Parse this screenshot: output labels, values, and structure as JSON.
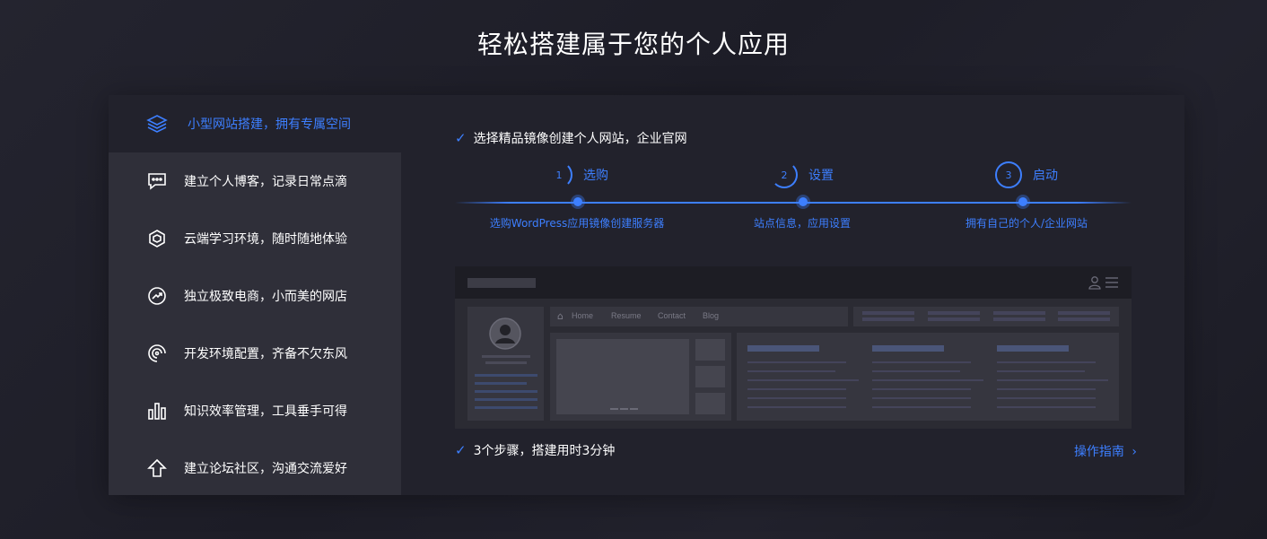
{
  "title": "轻松搭建属于您的个人应用",
  "sidebar": {
    "items": [
      {
        "label": "小型网站搭建，拥有专属空间",
        "icon": "layers-icon"
      },
      {
        "label": "建立个人博客，记录日常点滴",
        "icon": "chat-icon"
      },
      {
        "label": "云端学习环境，随时随地体验",
        "icon": "cube-icon"
      },
      {
        "label": "独立极致电商，小而美的网店",
        "icon": "trend-icon"
      },
      {
        "label": "开发环境配置，齐备不欠东风",
        "icon": "swirl-icon"
      },
      {
        "label": "知识效率管理，工具垂手可得",
        "icon": "bars-icon"
      },
      {
        "label": "建立论坛社区，沟通交流爱好",
        "icon": "arrow-up-icon"
      }
    ]
  },
  "main": {
    "headline": "选择精品镜像创建个人网站，企业官网",
    "steps": [
      {
        "num": "1",
        "label": "选购",
        "desc": "选购WordPress应用镜像创建服务器"
      },
      {
        "num": "2",
        "label": "设置",
        "desc": "站点信息，应用设置"
      },
      {
        "num": "3",
        "label": "启动",
        "desc": "拥有自己的个人/企业网站"
      }
    ],
    "preview": {
      "nav": [
        "Home",
        "Resume",
        "Contact",
        "Blog"
      ]
    },
    "footer_note": "3个步骤，搭建用时3分钟",
    "guide_link": "操作指南"
  },
  "colors": {
    "accent": "#3d7fff",
    "panel": "#22222c",
    "sidebar": "#2f2f39"
  }
}
